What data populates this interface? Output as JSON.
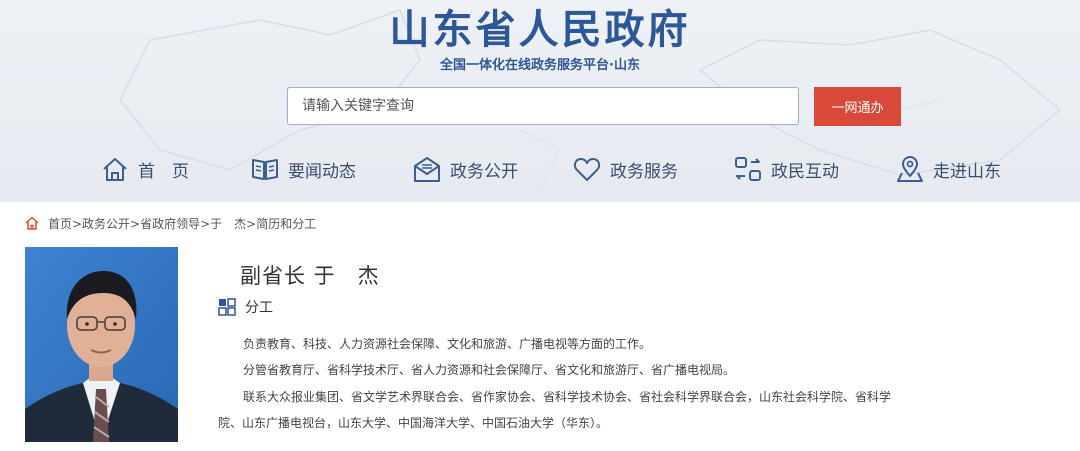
{
  "header": {
    "site_title": "山东省人民政府",
    "site_subtitle": "全国一体化在线政务服务平台·山东",
    "search_placeholder": "请输入关键字查询",
    "search_button": "一网通办"
  },
  "nav": {
    "items": [
      {
        "label": "首　页",
        "icon": "home-icon"
      },
      {
        "label": "要闻动态",
        "icon": "book-icon"
      },
      {
        "label": "政务公开",
        "icon": "mail-icon"
      },
      {
        "label": "政务服务",
        "icon": "heart-icon"
      },
      {
        "label": "政民互动",
        "icon": "interaction-icon"
      },
      {
        "label": "走进山东",
        "icon": "map-pin-icon"
      }
    ]
  },
  "breadcrumb": {
    "icon": "home-icon",
    "text": "首页>政务公开>省政府领导>于　杰>简历和分工"
  },
  "profile": {
    "name_line": "副省长 于　杰",
    "section_title": "分工",
    "section_icon": "grid-icon",
    "paragraphs": [
      "负责教育、科技、人力资源社会保障、文化和旅游、广播电视等方面的工作。",
      "分管省教育厅、省科学技术厅、省人力资源和社会保障厅、省文化和旅游厅、省广播电视局。",
      "联系大众报业集团、省文学艺术界联合会、省作家协会、省科学技术协会、省社会科学界联合会，山东社会科学院、省科学院、山东广播电视台，山东大学、中国海洋大学、中国石油大学（华东）。"
    ]
  },
  "colors": {
    "brand_blue": "#2c5798",
    "search_button": "#d8493a",
    "header_bg": "#e9edf3",
    "photo_bg": "#2f74c4"
  }
}
